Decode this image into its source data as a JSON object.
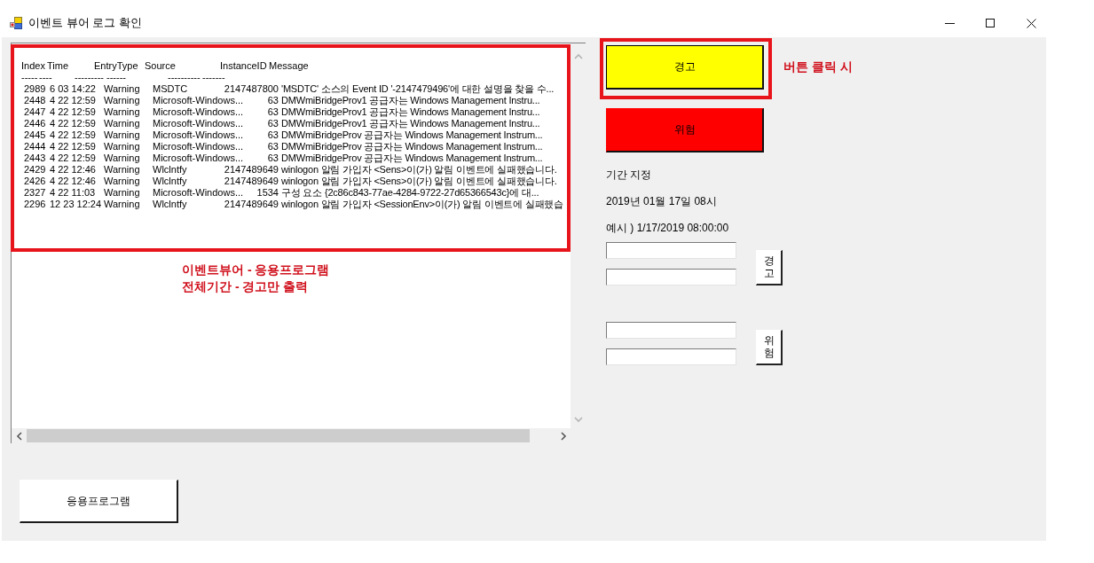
{
  "window": {
    "title": "이벤트 뷰어 로그 확인"
  },
  "event_list": {
    "highlighted": true,
    "columns": [
      "Index",
      "Time",
      "EntryType",
      "Source",
      "InstanceID",
      "Message"
    ],
    "underlines": [
      "-----",
      "----",
      "---------",
      "------",
      "----------",
      "-------"
    ],
    "rows": [
      {
        "index": "2989",
        "time": "6 03 14:22",
        "entry_type": "Warning",
        "source": "MSDTC",
        "instance_id": "2147487800",
        "message": "'MSDTC' 소스의 Event ID '-2147479496'에 대한 설명을 찾을 수..."
      },
      {
        "index": "2448",
        "time": "4 22 12:59",
        "entry_type": "Warning",
        "source": "Microsoft-Windows...",
        "instance_id": "63",
        "message": "DMWmiBridgeProv1 공급자는 Windows Management Instru..."
      },
      {
        "index": "2447",
        "time": "4 22 12:59",
        "entry_type": "Warning",
        "source": "Microsoft-Windows...",
        "instance_id": "63",
        "message": "DMWmiBridgeProv1 공급자는 Windows Management Instru..."
      },
      {
        "index": "2446",
        "time": "4 22 12:59",
        "entry_type": "Warning",
        "source": "Microsoft-Windows...",
        "instance_id": "63",
        "message": "DMWmiBridgeProv1 공급자는 Windows Management Instru..."
      },
      {
        "index": "2445",
        "time": "4 22 12:59",
        "entry_type": "Warning",
        "source": "Microsoft-Windows...",
        "instance_id": "63",
        "message": "DMWmiBridgeProv 공급자는 Windows Management Instrum..."
      },
      {
        "index": "2444",
        "time": "4 22 12:59",
        "entry_type": "Warning",
        "source": "Microsoft-Windows...",
        "instance_id": "63",
        "message": "DMWmiBridgeProv 공급자는 Windows Management Instrum..."
      },
      {
        "index": "2443",
        "time": "4 22 12:59",
        "entry_type": "Warning",
        "source": "Microsoft-Windows...",
        "instance_id": "63",
        "message": "DMWmiBridgeProv 공급자는 Windows Management Instrum..."
      },
      {
        "index": "2429",
        "time": "4 22 12:46",
        "entry_type": "Warning",
        "source": "Wlclntfy",
        "instance_id": "2147489649",
        "message": "winlogon 알림 가입자 <Sens>이(가) 알림 이벤트에 실패했습니다."
      },
      {
        "index": "2426",
        "time": "4 22 12:46",
        "entry_type": "Warning",
        "source": "Wlclntfy",
        "instance_id": "2147489649",
        "message": "winlogon 알림 가입자 <Sens>이(가) 알림 이벤트에 실패했습니다."
      },
      {
        "index": "2327",
        "time": "4 22 11:03",
        "entry_type": "Warning",
        "source": "Microsoft-Windows...",
        "instance_id": "1534",
        "message": "구성 요소 {2c86c843-77ae-4284-9722-27d65366543c}에 대..."
      },
      {
        "index": "2296",
        "time": "12 23 12:24",
        "entry_type": "Warning",
        "source": "Wlclntfy",
        "instance_id": "2147489649",
        "message": "winlogon 알림 가입자 <SessionEnv>이(가) 알림 이벤트에 실패했습"
      }
    ],
    "note": [
      "이벤트뷰어 - 응용프로그램",
      "전체기간 - 경고만 출력"
    ]
  },
  "level_buttons": [
    {
      "label": "경고",
      "color": "#ffff00",
      "focused": true,
      "highlighted": true,
      "note": "버튼 클릭 시"
    },
    {
      "label": "위험",
      "color": "#ff0000",
      "focused": false,
      "highlighted": false
    }
  ],
  "period": {
    "label": "기간 지정",
    "date": "2019년 01월 17일 08시",
    "example": "예시 ) 1/17/2019 08:00:00",
    "ranges": [
      {
        "button": "경고"
      },
      {
        "button": "위험"
      }
    ]
  },
  "application_button": {
    "label": "응용프로그램"
  }
}
